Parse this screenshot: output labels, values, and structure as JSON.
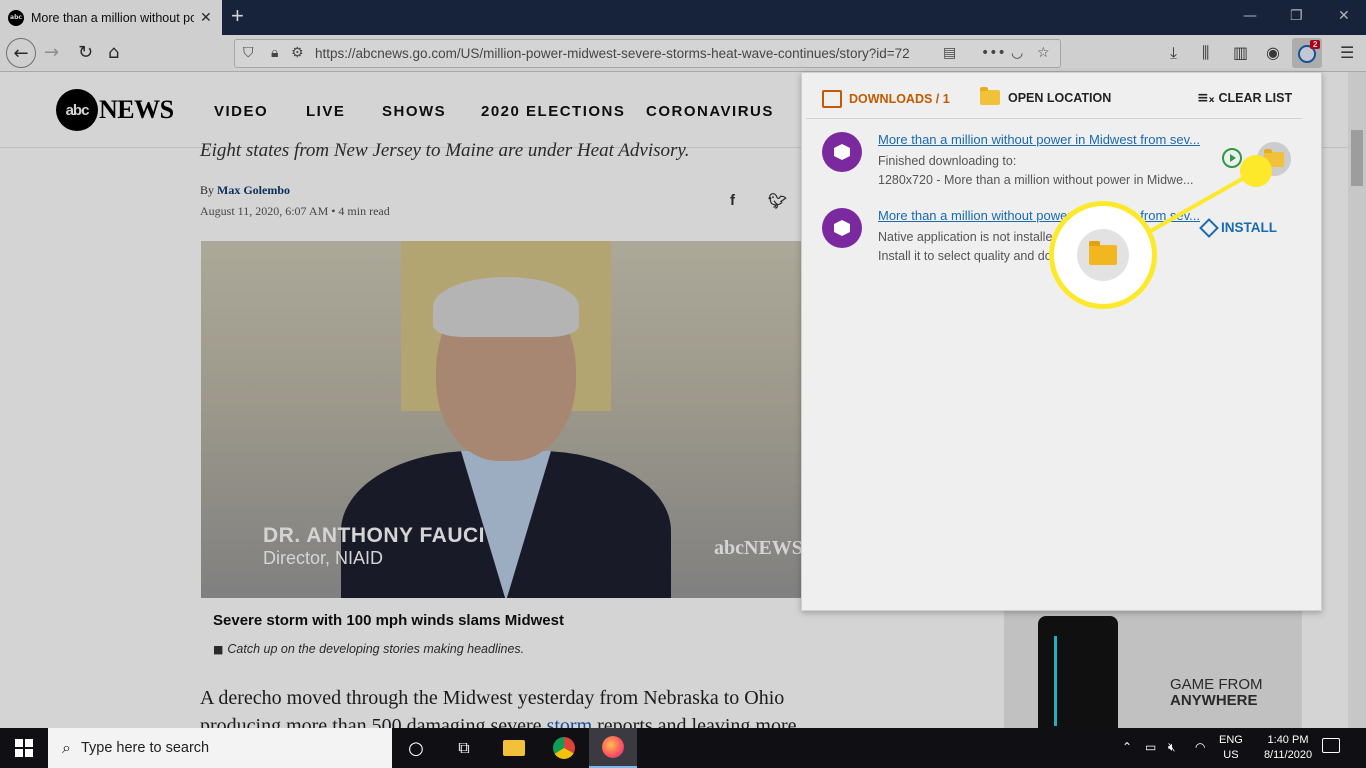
{
  "browser": {
    "tab_title": "More than a million without power in Midwest",
    "tab_close": "✕",
    "new_tab": "+",
    "url": "https://abcnews.go.com/US/million-power-midwest-severe-storms-heat-wave-continues/story?id=72",
    "extension_badge": "2"
  },
  "site": {
    "logo_mark": "abc",
    "logo_text": "NEWS",
    "nav": [
      "VIDEO",
      "LIVE",
      "SHOWS",
      "2020 ELECTIONS",
      "CORONAVIRUS"
    ]
  },
  "article": {
    "subheadline": "Eight states from New Jersey to Maine are under Heat Advisory.",
    "by": "By ",
    "author": "Max Golembo",
    "date": "August 11, 2020, 6:07 AM",
    "read_time": " • 4 min read",
    "video_lower_name": "DR. ANTHONY FAUCI",
    "video_lower_title": "Director, NIAID",
    "video_logo": "abcNEWS",
    "caption_title": "Severe storm with 100 mph winds slams Midwest",
    "caption_sub": "Catch up on the developing stories making headlines.",
    "body_start": "A derecho moved through the Midwest yesterday from Nebraska to Ohio producing more than 500 damaging severe ",
    "body_link": "storm",
    "body_end": " reports and leaving more"
  },
  "ad": {
    "line1": "GAME FROM",
    "line2": "ANYWHERE"
  },
  "downloads_popup": {
    "header_downloads": "DOWNLOADS / 1",
    "header_open": "OPEN LOCATION",
    "header_clear": "CLEAR LIST",
    "entries": [
      {
        "title": "More than a million without power in Midwest from sev...",
        "line1": "Finished downloading to:",
        "line2": "1280x720 - More than a million without power in Midwe..."
      },
      {
        "title": "More than a million without power in Midwest from sev...",
        "line1": "Native application is not installed.",
        "line2": "Install it to select quality and download.",
        "action": "INSTALL"
      }
    ]
  },
  "taskbar": {
    "search_placeholder": "Type here to search",
    "lang_1": "ENG",
    "lang_2": "US",
    "time": "1:40 PM",
    "date": "8/11/2020"
  },
  "colors": {
    "highlight": "#fde82a",
    "downloads_accent": "#c25a00",
    "link": "#1a6ab0"
  }
}
